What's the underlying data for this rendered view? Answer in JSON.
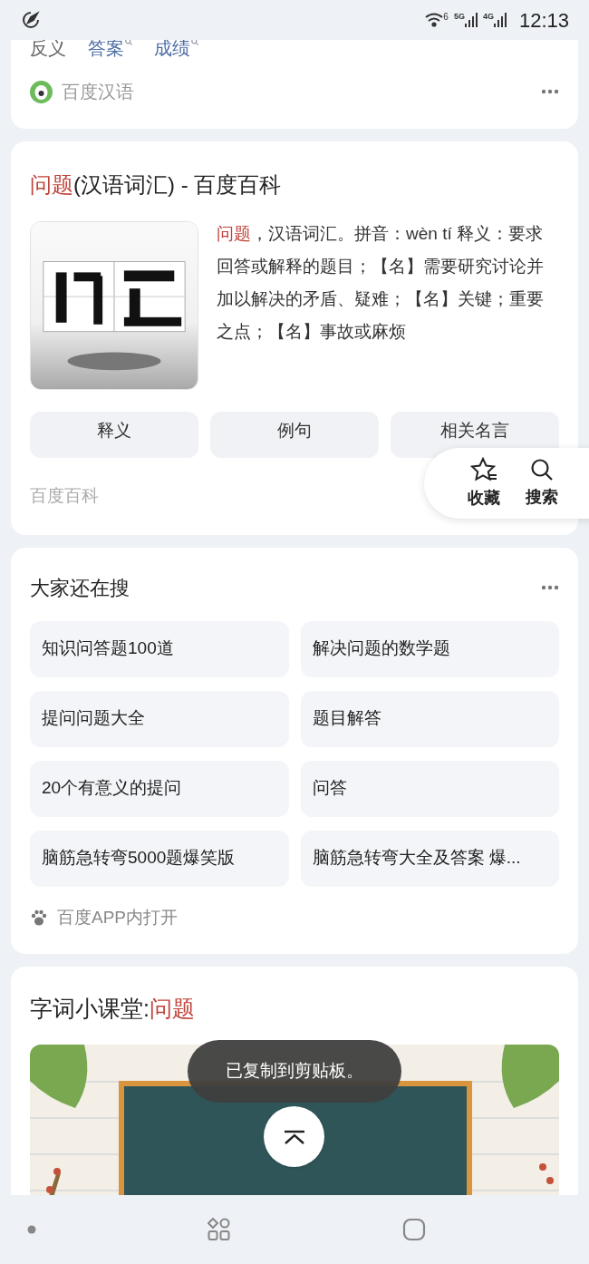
{
  "status_bar": {
    "wifi_label": "6",
    "network_labels": [
      "5G",
      "4G"
    ],
    "time": "12:13"
  },
  "top_card": {
    "words": [
      {
        "text": "反义",
        "link": false
      },
      {
        "text": "答案",
        "link": true
      },
      {
        "text": "成绩",
        "link": true
      }
    ],
    "source": "百度汉语"
  },
  "baike_card": {
    "title_highlight": "问题",
    "title_rest": "(汉语词汇) - 百度百科",
    "summary_highlight": "问题",
    "summary": "，汉语词汇。拼音：wèn tí 释义：要求回答或解释的题目；【名】需要研究讨论并加以解决的矛盾、疑难；【名】关键；重要之点；【名】事故或麻烦",
    "tabs": [
      "释义",
      "例句",
      "相关名言"
    ],
    "source": "百度百科"
  },
  "float_actions": [
    {
      "kind": "star",
      "label": "收藏"
    },
    {
      "kind": "search",
      "label": "搜索"
    }
  ],
  "related": {
    "title": "大家还在搜",
    "items": [
      "知识问答题100道",
      "解决问题的数学题",
      "提问问题大全",
      "题目解答",
      "20个有意义的提问",
      "问答",
      "脑筋急转弯5000题爆笑版",
      "脑筋急转弯大全及答案 爆..."
    ],
    "footer": "百度APP内打开"
  },
  "lesson": {
    "title": "字词小课堂:",
    "highlight": "问题"
  },
  "toast": "已复制到剪贴板。"
}
